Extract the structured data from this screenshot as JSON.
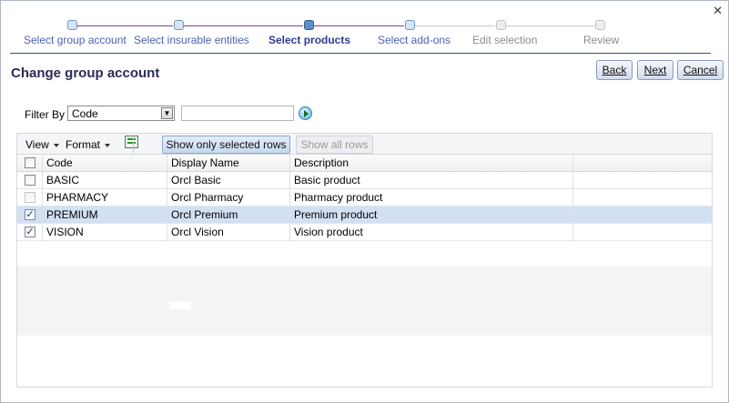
{
  "window": {
    "close_glyph": "✕"
  },
  "train": {
    "steps": [
      {
        "label": "Select group account",
        "state": "visited"
      },
      {
        "label": "Select insurable entities",
        "state": "visited"
      },
      {
        "label": "Select products",
        "state": "current"
      },
      {
        "label": "Select add-ons",
        "state": "next"
      },
      {
        "label": "Edit selection",
        "state": "unvisited"
      },
      {
        "label": "Review",
        "state": "unvisited"
      }
    ]
  },
  "page": {
    "title": "Change group account"
  },
  "nav_buttons": {
    "back": "Back",
    "next": "Next",
    "cancel": "Cancel"
  },
  "filter": {
    "label": "Filter By",
    "selected": "Code",
    "value": "",
    "go_icon": "go-arrow-icon"
  },
  "toolbar": {
    "view": "View",
    "format": "Format",
    "export_icon": "excel-export-icon",
    "show_selected": "Show only selected rows",
    "show_all": "Show all rows"
  },
  "table": {
    "columns": [
      "Code",
      "Display Name",
      "Description"
    ],
    "rows": [
      {
        "code": "BASIC",
        "display_name": "Orcl Basic",
        "description": "Basic product",
        "checked": false,
        "selected": false,
        "dim": false
      },
      {
        "code": "PHARMACY",
        "display_name": "Orcl Pharmacy",
        "description": "Pharmacy product",
        "checked": false,
        "selected": false,
        "dim": true
      },
      {
        "code": "PREMIUM",
        "display_name": "Orcl Premium",
        "description": "Premium product",
        "checked": true,
        "selected": true,
        "dim": false
      },
      {
        "code": "VISION",
        "display_name": "Orcl Vision",
        "description": "Vision product",
        "checked": true,
        "selected": false,
        "dim": false
      }
    ]
  },
  "colors": {
    "visited": "#4a63b0",
    "current": "#2e3c93",
    "unvisited": "#8c8c8c",
    "selected_row": "#d3e0f3",
    "title": "#2b2b56"
  }
}
